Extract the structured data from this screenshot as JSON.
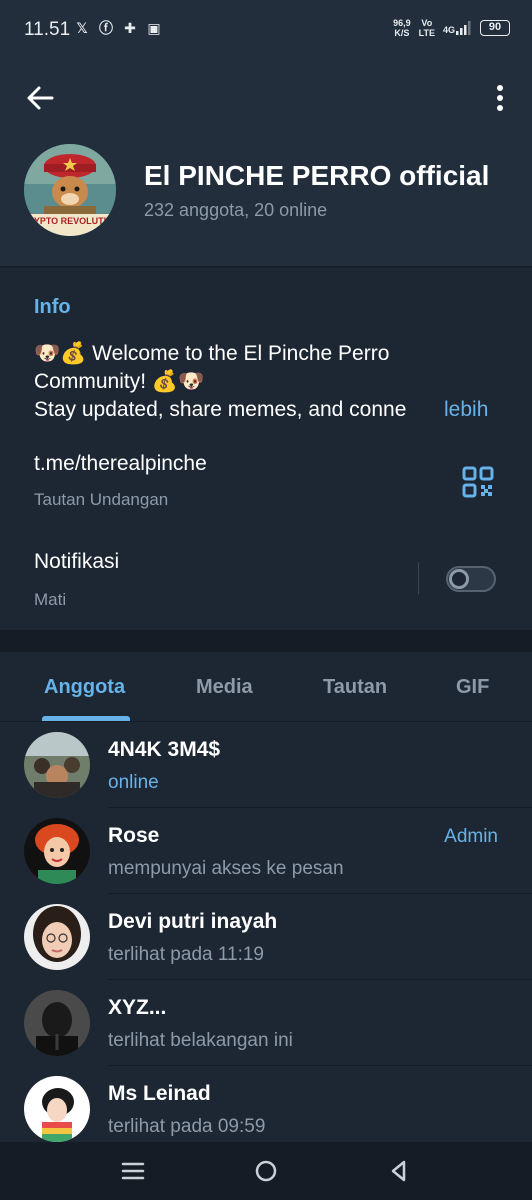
{
  "status_bar": {
    "time": "11.51",
    "speed_value": "96,9",
    "speed_unit": "K/S",
    "vo": "Vo",
    "lte": "LTE",
    "network": "4G",
    "battery": "90"
  },
  "header": {
    "title": "El PINCHE PERRO official",
    "subtitle": "232 anggota, 20 online",
    "avatar_caption": "YPTO REVOLUTI"
  },
  "info": {
    "label": "Info",
    "description_line1": "🐶💰 Welcome to the El Pinche Perro",
    "description_line2": "Community! 💰🐶",
    "description_line3": "Stay updated, share memes, and conne",
    "more": "lebih",
    "link": "t.me/therealpinche",
    "link_sub": "Tautan Undangan",
    "notif_label": "Notifikasi",
    "notif_sub": "Mati"
  },
  "tabs": [
    {
      "label": "Anggota"
    },
    {
      "label": "Media"
    },
    {
      "label": "Tautan"
    },
    {
      "label": "GIF"
    }
  ],
  "members": [
    {
      "name": "4N4K 3M4$",
      "status": "online",
      "role": ""
    },
    {
      "name": "Rose",
      "status": "mempunyai akses ke pesan",
      "role": "Admin"
    },
    {
      "name": "Devi putri inayah",
      "status": "terlihat pada  11:19",
      "role": ""
    },
    {
      "name": "XYZ...",
      "status": "terlihat belakangan ini",
      "role": ""
    },
    {
      "name": "Ms Leinad",
      "status": "terlihat pada  09:59",
      "role": ""
    }
  ],
  "colors": {
    "accent": "#67b2e8",
    "background": "#1d2733",
    "header": "#232e3c",
    "muted": "#8d9aa8"
  }
}
